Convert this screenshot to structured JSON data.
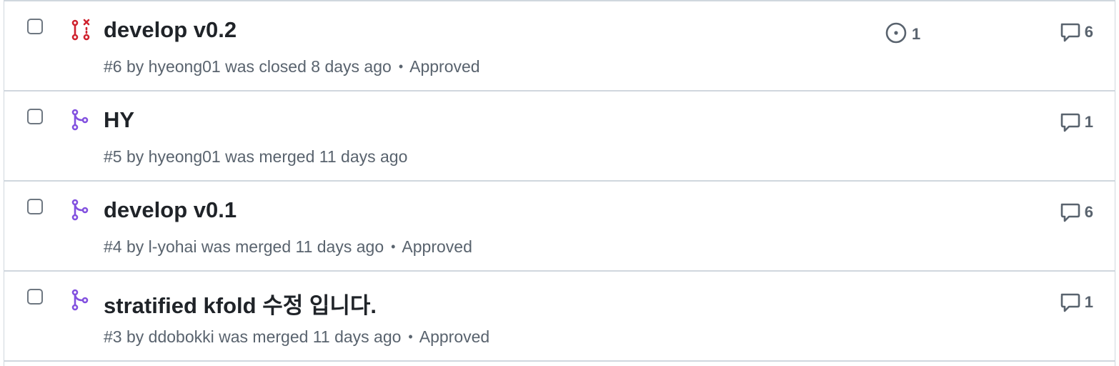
{
  "colors": {
    "closed": "#cf222e",
    "merged": "#8250df",
    "muted": "#59636e",
    "border": "#d0d7de"
  },
  "pull_requests": [
    {
      "state": "closed",
      "state_icon": "git-pull-request-closed-icon",
      "title": "develop v0.2",
      "number": "#6",
      "by": "by",
      "author": "hyeong01",
      "action": "was closed 8 days ago",
      "review": "Approved",
      "linked_issues": "1",
      "comments": "6"
    },
    {
      "state": "merged",
      "state_icon": "git-merge-icon",
      "title": "HY",
      "number": "#5",
      "by": "by",
      "author": "hyeong01",
      "action": "was merged 11 days ago",
      "review": "",
      "linked_issues": "",
      "comments": "1"
    },
    {
      "state": "merged",
      "state_icon": "git-merge-icon",
      "title": "develop v0.1",
      "number": "#4",
      "by": "by",
      "author": "l-yohai",
      "action": "was merged 11 days ago",
      "review": "Approved",
      "linked_issues": "",
      "comments": "6"
    },
    {
      "state": "merged",
      "state_icon": "git-merge-icon",
      "title": "stratified kfold 수정 입니다.",
      "number": "#3",
      "by": "by",
      "author": "ddobokki",
      "action": "was merged 11 days ago",
      "review": "Approved",
      "linked_issues": "",
      "comments": "1"
    }
  ]
}
